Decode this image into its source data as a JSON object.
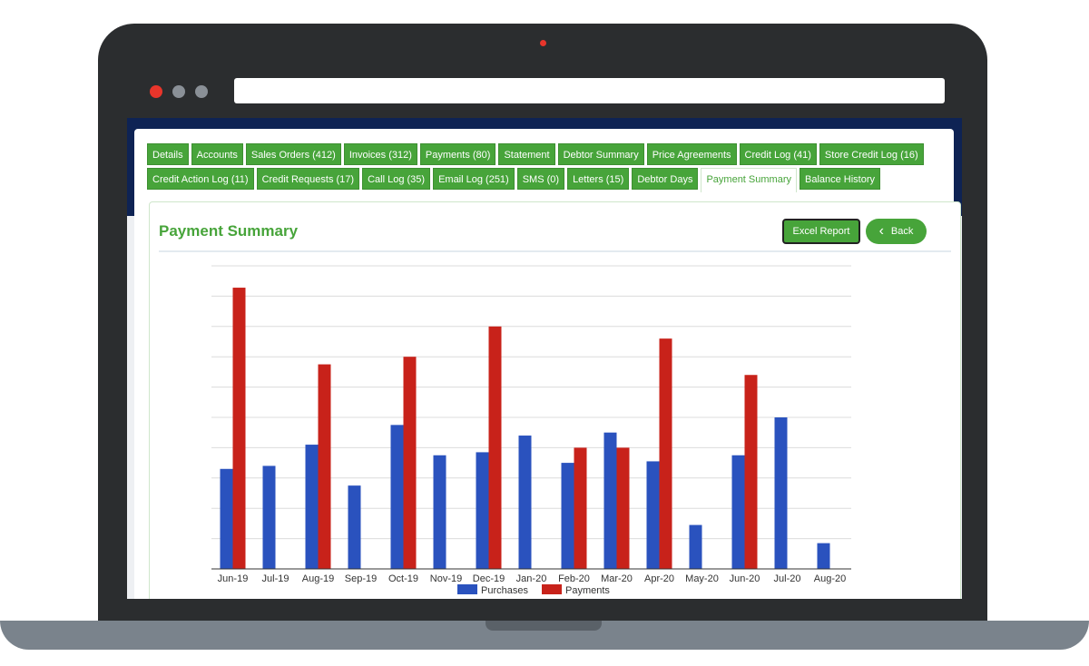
{
  "tabs_row1": [
    "Details",
    "Accounts",
    "Sales Orders (412)",
    "Invoices (312)",
    "Payments (80)",
    "Statement",
    "Debtor Summary",
    "Price Agreements",
    "Credit Log (41)",
    "Store Credit Log (16)"
  ],
  "tabs_row2": [
    "Credit Action Log (11)",
    "Credit Requests (17)",
    "Call Log (35)",
    "Email Log (251)",
    "SMS (0)",
    "Letters (15)",
    "Debtor Days",
    "Payment Summary",
    "Balance History"
  ],
  "active_tab": "Payment Summary",
  "page_title": "Payment Summary",
  "buttons": {
    "excel": "Excel Report",
    "back": "Back"
  },
  "colors": {
    "accent": "#47a43a",
    "purchases": "#2a52be",
    "payments": "#c8221a"
  },
  "chart_data": {
    "type": "bar",
    "categories": [
      "Jun-19",
      "Jul-19",
      "Aug-19",
      "Sep-19",
      "Oct-19",
      "Nov-19",
      "Dec-19",
      "Jan-20",
      "Feb-20",
      "Mar-20",
      "Apr-20",
      "May-20",
      "Jun-20",
      "Jul-20",
      "Aug-20"
    ],
    "series": [
      {
        "name": "Purchases",
        "values": [
          3.3,
          3.4,
          4.1,
          2.75,
          4.75,
          3.75,
          3.85,
          4.4,
          3.5,
          4.5,
          3.55,
          1.45,
          3.75,
          5.0,
          0.85
        ]
      },
      {
        "name": "Payments",
        "values": [
          9.28,
          0,
          6.75,
          0,
          7.0,
          0,
          8.0,
          0,
          4.0,
          4.0,
          7.6,
          0,
          6.4,
          0,
          0
        ]
      }
    ],
    "ylim": [
      0,
      10
    ],
    "grid": true,
    "legend": "bottom",
    "note_units": "y-axis unlabelled; values in gridline units"
  }
}
